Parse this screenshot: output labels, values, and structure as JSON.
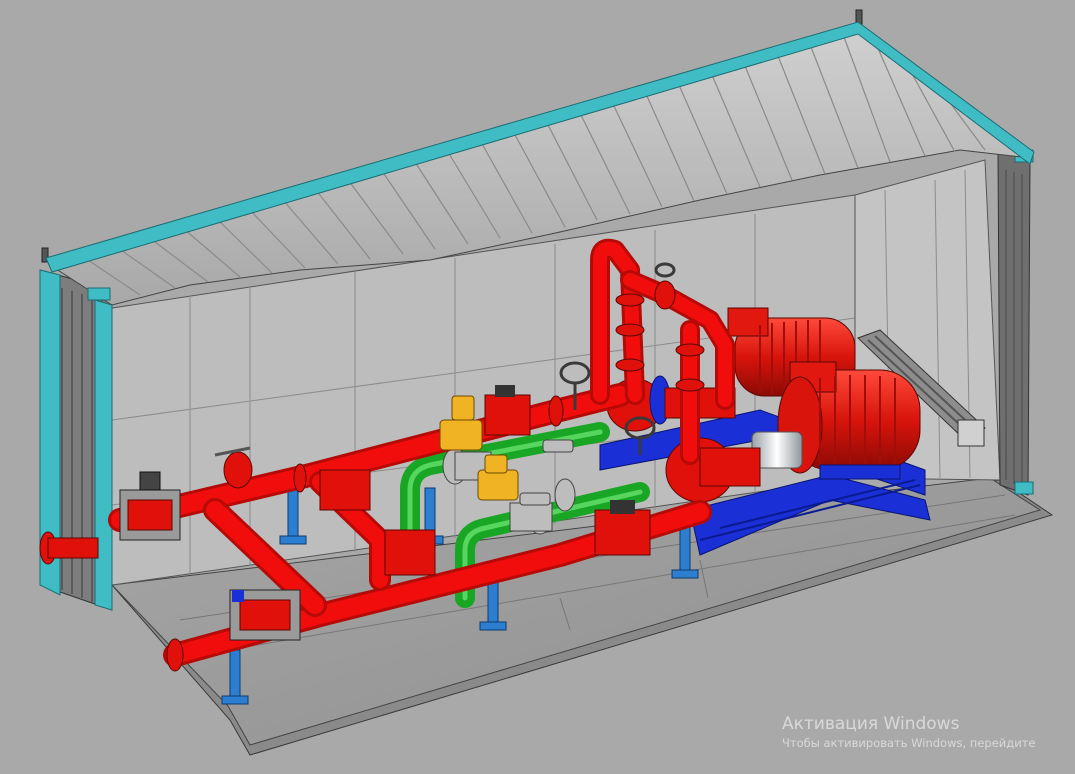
{
  "colors": {
    "background": "#a9a9a9",
    "container_frame": "#3fbcc4",
    "container_wall": "#b9b9b9",
    "container_floor": "#9e9e9e",
    "pipe_fire": "#f20d0d",
    "pipe_bypass": "#18a624",
    "pump_base": "#1a2fd6",
    "supports": "#2c7fd0",
    "valve_yellow": "#f0b323",
    "valve_grey": "#bdbdbd"
  },
  "watermark": {
    "title": "Активация Windows",
    "subtitle": "Чтобы активировать Windows, перейдите"
  }
}
